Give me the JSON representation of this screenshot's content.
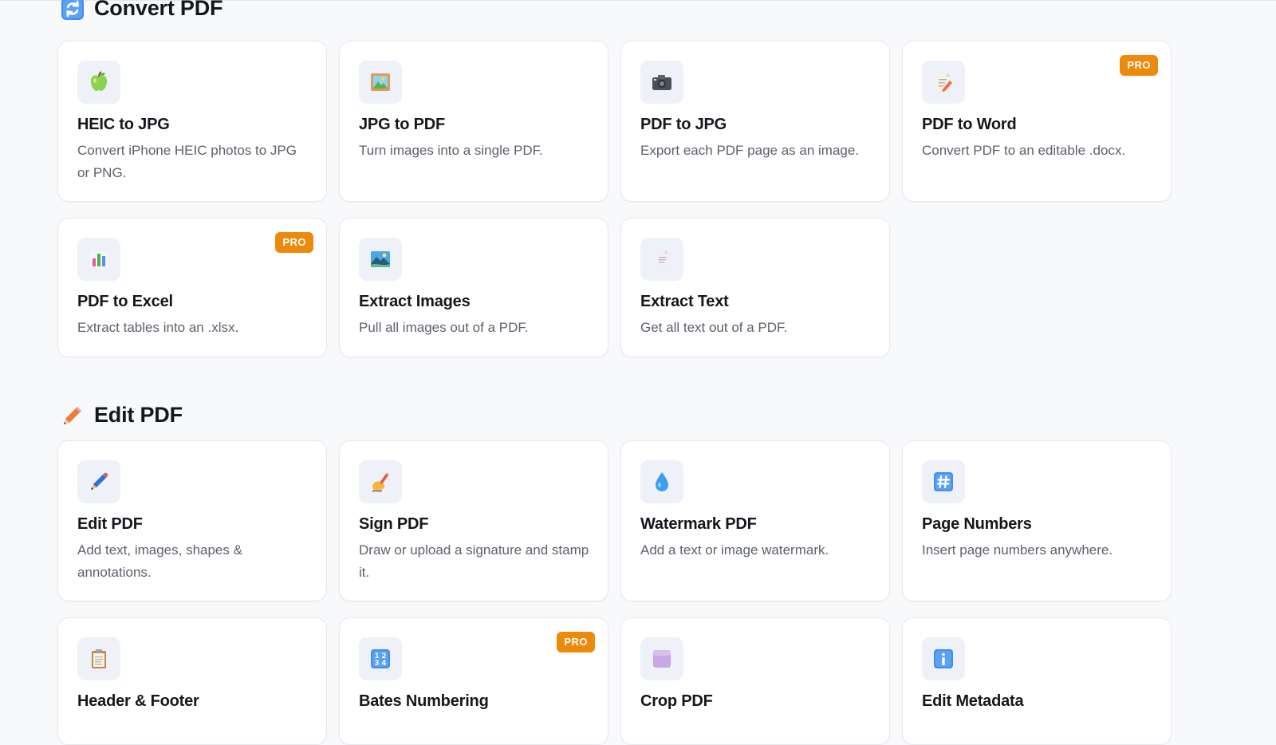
{
  "sections": {
    "convert": {
      "title": "Convert PDF",
      "icon": "refresh-arrows-icon",
      "cards": [
        {
          "title": "HEIC to JPG",
          "desc": "Convert iPhone HEIC photos to JPG or PNG.",
          "icon": "green-apple-icon",
          "pro": ""
        },
        {
          "title": "JPG to PDF",
          "desc": "Turn images into a single PDF.",
          "icon": "framed-picture-icon",
          "pro": ""
        },
        {
          "title": "PDF to JPG",
          "desc": "Export each PDF page as an image.",
          "icon": "camera-icon",
          "pro": ""
        },
        {
          "title": "PDF to Word",
          "desc": "Convert PDF to an editable .docx.",
          "icon": "memo-icon",
          "pro": "PRO"
        },
        {
          "title": "PDF to Excel",
          "desc": "Extract tables into an .xlsx.",
          "icon": "bar-chart-icon",
          "pro": "PRO"
        },
        {
          "title": "Extract Images",
          "desc": "Pull all images out of a PDF.",
          "icon": "landscape-image-icon",
          "pro": ""
        },
        {
          "title": "Extract Text",
          "desc": "Get all text out of a PDF.",
          "icon": "document-icon",
          "pro": ""
        }
      ]
    },
    "edit": {
      "title": "Edit PDF",
      "icon": "pencil-icon",
      "cards": [
        {
          "title": "Edit PDF",
          "desc": "Add text, images, shapes & annotations.",
          "icon": "pen-icon",
          "pro": ""
        },
        {
          "title": "Sign PDF",
          "desc": "Draw or upload a signature and stamp it.",
          "icon": "writing-hand-icon",
          "pro": ""
        },
        {
          "title": "Watermark PDF",
          "desc": "Add a text or image watermark.",
          "icon": "droplet-icon",
          "pro": ""
        },
        {
          "title": "Page Numbers",
          "desc": "Insert page numbers anywhere.",
          "icon": "hash-keycap-icon",
          "pro": ""
        },
        {
          "title": "Header & Footer",
          "desc": "",
          "icon": "clipboard-icon",
          "pro": ""
        },
        {
          "title": "Bates Numbering",
          "desc": "",
          "icon": "numbers-keycap-icon",
          "pro": "PRO"
        },
        {
          "title": "Crop PDF",
          "desc": "",
          "icon": "purple-square-icon",
          "pro": ""
        },
        {
          "title": "Edit Metadata",
          "desc": "",
          "icon": "info-icon",
          "pro": ""
        }
      ]
    }
  }
}
